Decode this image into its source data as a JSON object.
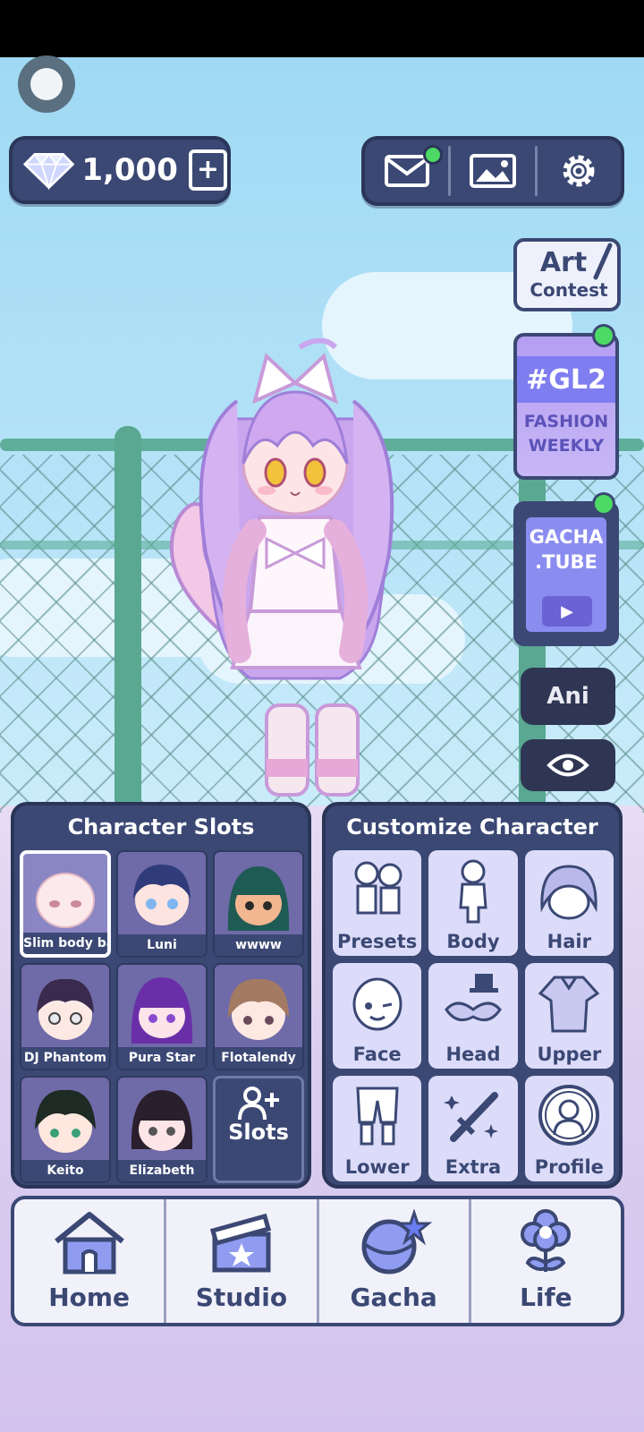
{
  "currency": {
    "gems": "1,000",
    "add_icon": "plus-box-icon"
  },
  "top_bar": {
    "icons": [
      "mail-icon",
      "gallery-icon",
      "gear-icon"
    ]
  },
  "side": {
    "art_contest": {
      "line1": "Art",
      "line2": "Contest"
    },
    "gl2": {
      "title": "#GL2",
      "line1": "FASHION",
      "line2": "WEEKLY"
    },
    "gacha_tube": {
      "line1": "GACHA",
      "line2": ".TUBE"
    },
    "ani_label": "Ani",
    "eye_icon": "eye-icon"
  },
  "slots_panel": {
    "title": "Character Slots",
    "slots": [
      {
        "label": "Slim body bas",
        "selected": true
      },
      {
        "label": "Luni"
      },
      {
        "label": "wwww"
      },
      {
        "label": "DJ Phantom"
      },
      {
        "label": "Pura Star"
      },
      {
        "label": "Flotalendy"
      },
      {
        "label": "Keito"
      },
      {
        "label": "Elizabeth"
      }
    ],
    "add_label": "Slots"
  },
  "customize_panel": {
    "title": "Customize Character",
    "items": [
      "Presets",
      "Body",
      "Hair",
      "Face",
      "Head",
      "Upper",
      "Lower",
      "Extra",
      "Profile"
    ]
  },
  "nav": {
    "items": [
      "Home",
      "Studio",
      "Gacha",
      "Life"
    ]
  },
  "colors": {
    "panel": "#3b4874",
    "accent_green": "#4cd964",
    "tile": "#dcdcfa"
  }
}
